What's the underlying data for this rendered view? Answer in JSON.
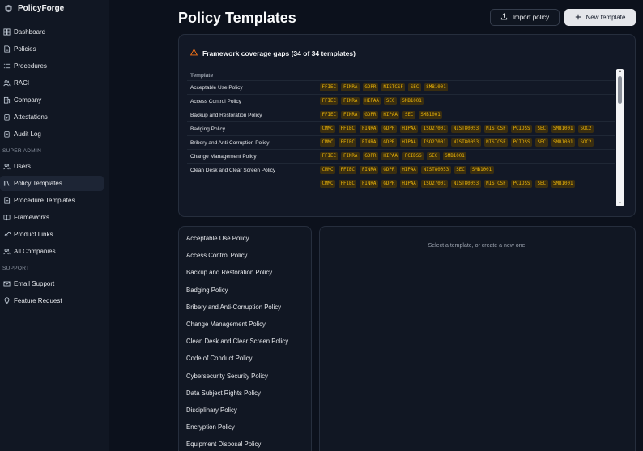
{
  "brand": {
    "name": "PolicyForge",
    "logo_icon": "shield-logo-icon"
  },
  "sidebar": {
    "items": [
      {
        "label": "Dashboard",
        "icon": "grid-icon"
      },
      {
        "label": "Policies",
        "icon": "document-icon"
      },
      {
        "label": "Procedures",
        "icon": "list-icon"
      },
      {
        "label": "RACI",
        "icon": "users-icon"
      },
      {
        "label": "Company",
        "icon": "building-icon"
      },
      {
        "label": "Attestations",
        "icon": "clipboard-check-icon"
      },
      {
        "label": "Audit Log",
        "icon": "clipboard-icon"
      }
    ],
    "super_admin_label": "SUPER ADMIN",
    "admin_items": [
      {
        "label": "Users",
        "icon": "users-icon"
      },
      {
        "label": "Policy Templates",
        "icon": "library-icon",
        "active": true
      },
      {
        "label": "Procedure Templates",
        "icon": "document-icon"
      },
      {
        "label": "Frameworks",
        "icon": "book-icon"
      },
      {
        "label": "Product Links",
        "icon": "link-icon"
      },
      {
        "label": "All Companies",
        "icon": "users-icon"
      }
    ],
    "support_label": "SUPPORT",
    "support_items": [
      {
        "label": "Email Support",
        "icon": "mail-icon"
      },
      {
        "label": "Feature Request",
        "icon": "lightbulb-icon"
      }
    ]
  },
  "header": {
    "title": "Policy Templates",
    "import_label": "Import policy",
    "new_label": "New template"
  },
  "coverage": {
    "title": "Framework coverage gaps (34 of 34 templates)",
    "column_header": "Template",
    "rows": [
      {
        "name": "Acceptable Use Policy",
        "tags": [
          "FFIEC",
          "FINRA",
          "GDPR",
          "NISTCSF",
          "SEC",
          "SMB1001"
        ]
      },
      {
        "name": "Access Control Policy",
        "tags": [
          "FFIEC",
          "FINRA",
          "HIPAA",
          "SEC",
          "SMB1001"
        ]
      },
      {
        "name": "Backup and Restoration Policy",
        "tags": [
          "FFIEC",
          "FINRA",
          "GDPR",
          "HIPAA",
          "SEC",
          "SMB1001"
        ]
      },
      {
        "name": "Badging Policy",
        "tags": [
          "CMMC",
          "FFIEC",
          "FINRA",
          "GDPR",
          "HIPAA",
          "ISO27001",
          "NIST80053",
          "NISTCSF",
          "PCIDSS",
          "SEC",
          "SMB1001",
          "SOC2"
        ]
      },
      {
        "name": "Bribery and Anti-Corruption Policy",
        "tags": [
          "CMMC",
          "FFIEC",
          "FINRA",
          "GDPR",
          "HIPAA",
          "ISO27001",
          "NIST80053",
          "NISTCSF",
          "PCIDSS",
          "SEC",
          "SMB1001",
          "SOC2"
        ]
      },
      {
        "name": "Change Management Policy",
        "tags": [
          "FFIEC",
          "FINRA",
          "GDPR",
          "HIPAA",
          "PCIDSS",
          "SEC",
          "SMB1001"
        ]
      },
      {
        "name": "Clean Desk and Clear Screen Policy",
        "tags": [
          "CMMC",
          "FFIEC",
          "FINRA",
          "GDPR",
          "HIPAA",
          "NIST80053",
          "SEC",
          "SMB1001"
        ]
      },
      {
        "name": "",
        "tags": [
          "CMMC",
          "FFIEC",
          "FINRA",
          "GDPR",
          "HIPAA",
          "ISO27001",
          "NIST80053",
          "NISTCSF",
          "PCIDSS",
          "SEC",
          "SMB1001"
        ]
      }
    ]
  },
  "templates": [
    "Acceptable Use Policy",
    "Access Control Policy",
    "Backup and Restoration Policy",
    "Badging Policy",
    "Bribery and Anti-Corruption Policy",
    "Change Management Policy",
    "Clean Desk and Clear Screen Policy",
    "Code of Conduct Policy",
    "Cybersecurity Security Policy",
    "Data Subject Rights Policy",
    "Disciplinary Policy",
    "Encryption Policy",
    "Equipment Disposal Policy"
  ],
  "detail": {
    "empty_message": "Select a template, or create a new one."
  },
  "colors": {
    "tag_text": "#eab308",
    "tag_bg": "#3a2e10",
    "warning": "#f97316"
  }
}
